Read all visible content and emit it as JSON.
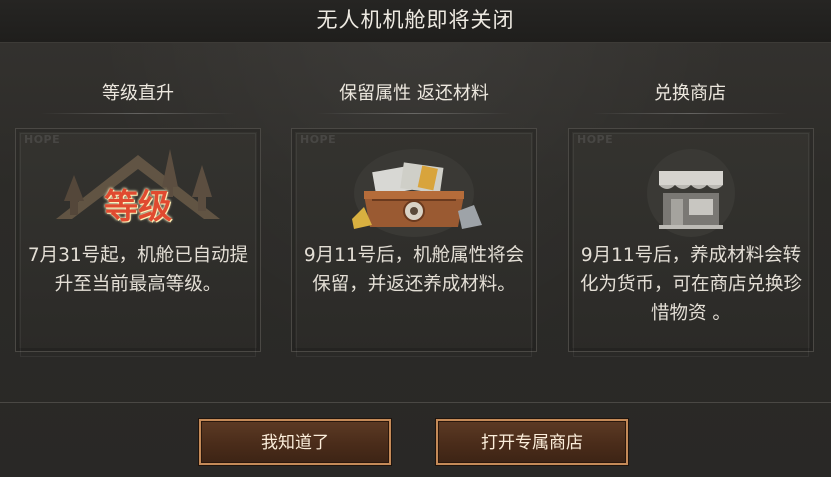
{
  "dialog": {
    "title": "无人机机舱即将关闭"
  },
  "columns": [
    {
      "heading": "等级直升",
      "watermark": "HOPE",
      "art_label": "等级",
      "text": "7月31号起，机舱已自动提升至当前最高等级。"
    },
    {
      "heading": "保留属性 返还材料",
      "watermark": "HOPE",
      "text": "9月11号后，机舱属性将会保留，并返还养成材料。"
    },
    {
      "heading": "兑换商店",
      "watermark": "HOPE",
      "text": "9月11号后，养成材料会转化为货币，可在商店兑换珍惜物资 。"
    }
  ],
  "buttons": {
    "confirm_label": "我知道了",
    "shop_label": "打开专属商店"
  },
  "colors": {
    "button_border": "#c48a58",
    "level_text": "#d9442c"
  }
}
